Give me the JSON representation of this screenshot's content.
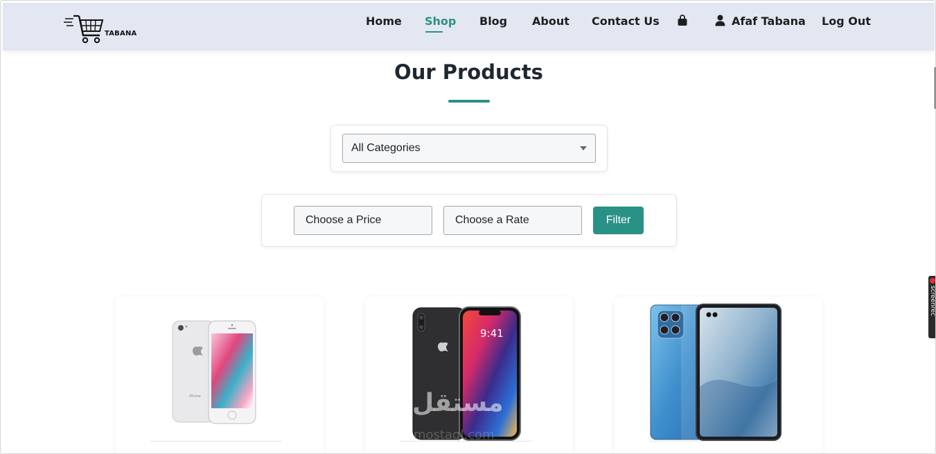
{
  "header": {
    "logo_text": "TABANA",
    "nav": {
      "home": "Home",
      "shop": "Shop",
      "blog": "Blog",
      "about": "About",
      "contact": "Contact Us",
      "user": "Afaf Tabana",
      "logout": "Log Out"
    },
    "active_item": "Shop",
    "icons": [
      "cart-logo-icon",
      "shopping-bag-icon",
      "user-icon"
    ]
  },
  "main": {
    "title": "Our Products",
    "category_select": {
      "value": "All Categories"
    },
    "price_select": {
      "value": "Choose a Price"
    },
    "rate_select": {
      "value": "Choose a Rate"
    },
    "filter_button": "Filter"
  },
  "products": [
    {
      "image": "iphone-8-silver"
    },
    {
      "image": "iphone-x-space-gray"
    },
    {
      "image": "oppo-blue-phone"
    }
  ],
  "overlay": {
    "recorder_label": "screenrec",
    "watermark_arabic": "مستقل",
    "watermark_latin": "mostaql.com"
  },
  "colors": {
    "accent": "#2a9186",
    "navbar_bg": "#e3e7f2",
    "text_dark": "#1f2730"
  }
}
